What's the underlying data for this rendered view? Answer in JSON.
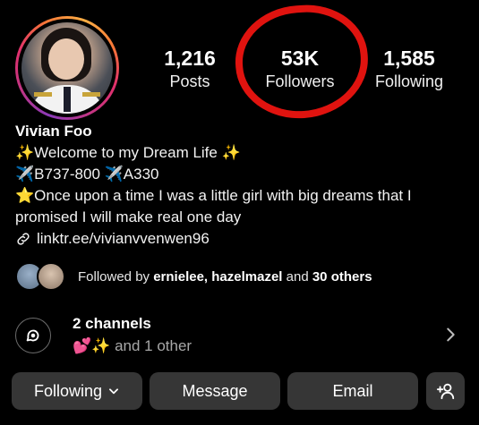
{
  "stats": {
    "posts": {
      "value": "1,216",
      "label": "Posts"
    },
    "followers": {
      "value": "53K",
      "label": "Followers"
    },
    "following": {
      "value": "1,585",
      "label": "Following"
    }
  },
  "profile": {
    "name": "Vivian Foo",
    "bio_line1": "✨Welcome to my Dream Life ✨",
    "bio_line2": "✈️B737-800 ✈️A330",
    "bio_line3": "⭐Once upon a time I was a little girl with big dreams that I promised I will make real one day",
    "link": "linktr.ee/vivianvvenwen96"
  },
  "followed_by": {
    "prefix": "Followed by ",
    "names": "ernielee, hazelmazel",
    "middle": " and ",
    "others": "30 others"
  },
  "channels": {
    "title": "2 channels",
    "emojis": "💕✨",
    "sub": " and 1 other"
  },
  "actions": {
    "following": "Following",
    "message": "Message",
    "email": "Email"
  },
  "colors": {
    "annotation_circle": "#e0130f",
    "button_bg": "#363636"
  }
}
